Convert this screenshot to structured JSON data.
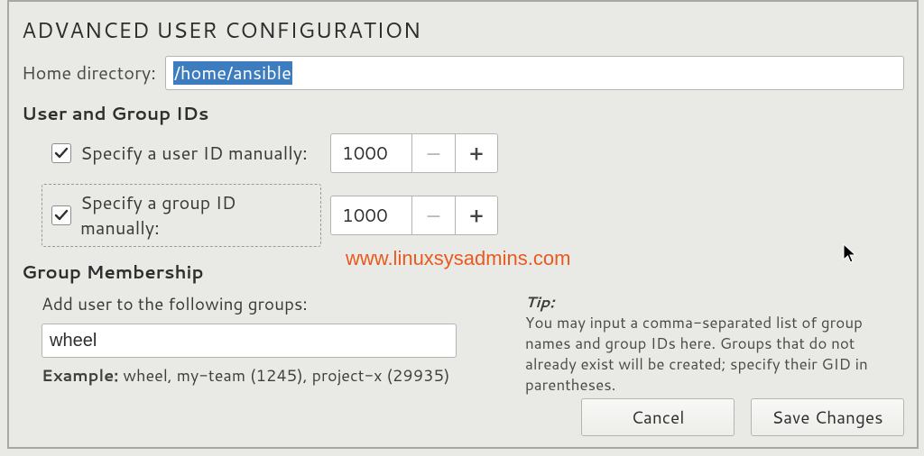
{
  "title": "ADVANCED USER CONFIGURATION",
  "home": {
    "label": "Home directory:",
    "value": "/home/ansible"
  },
  "ids": {
    "heading": "User and Group IDs",
    "user": {
      "label": "Specify a user ID manually:",
      "value": "1000"
    },
    "group": {
      "label": "Specify a group ID manually:",
      "value": "1000"
    }
  },
  "membership": {
    "heading": "Group Membership",
    "label": "Add user to the following groups:",
    "value": "wheel",
    "example_prefix": "Example:",
    "example_text": " wheel, my-team (1245), project-x (29935)",
    "tip_head": "Tip:",
    "tip_body": "You may input a comma-separated list of group names and group IDs here. Groups that do not already exist will be created; specify their GID in parentheses."
  },
  "watermark": "www.linuxsysadmins.com",
  "buttons": {
    "cancel": "Cancel",
    "save": "Save Changes"
  }
}
